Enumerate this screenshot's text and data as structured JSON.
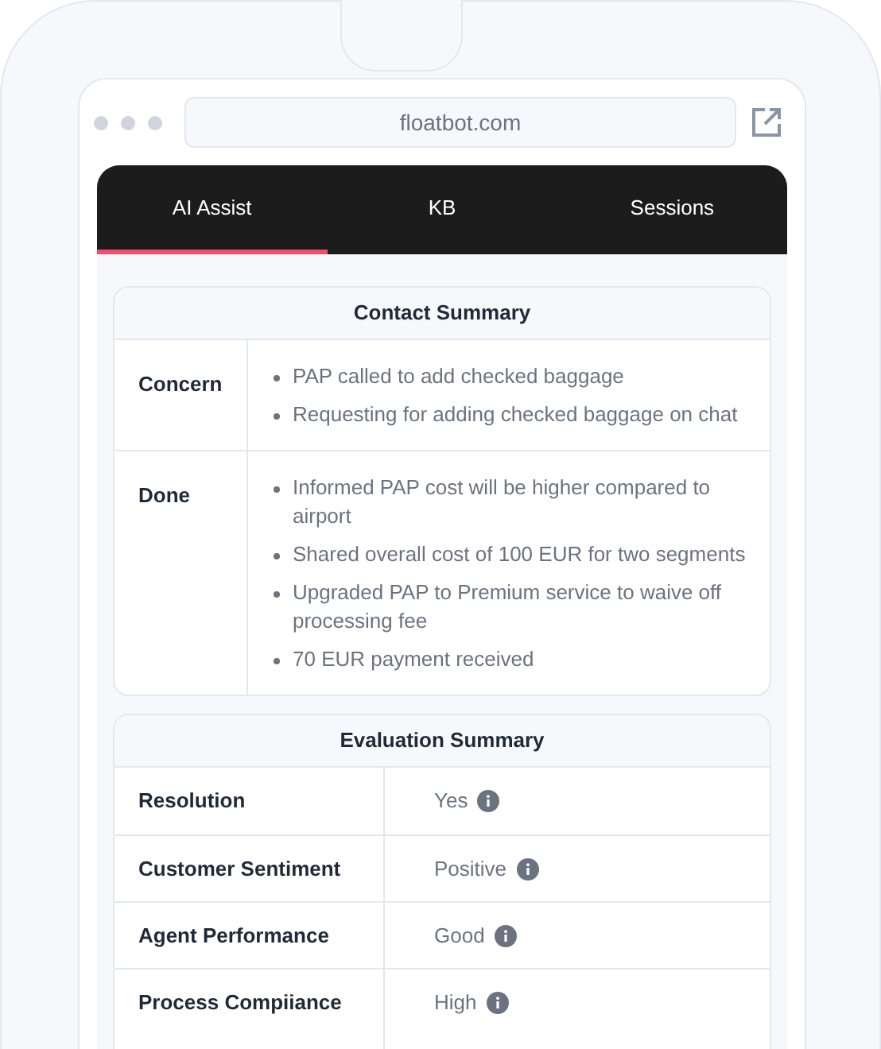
{
  "browser": {
    "url": "floatbot.com"
  },
  "tabs": [
    {
      "label": "AI Assist",
      "selected": true
    },
    {
      "label": "KB",
      "selected": false
    },
    {
      "label": "Sessions",
      "selected": false
    }
  ],
  "contact_summary": {
    "title": "Contact Summary",
    "rows": [
      {
        "label": "Concern",
        "items": [
          "PAP called to add checked baggage",
          "Requesting for adding checked baggage on chat"
        ]
      },
      {
        "label": "Done",
        "items": [
          "Informed PAP cost will be higher compared to airport",
          "Shared overall cost of 100 EUR for two segments",
          "Upgraded PAP to Premium service to waive off processing fee",
          "70 EUR payment received"
        ]
      }
    ]
  },
  "evaluation_summary": {
    "title": "Evaluation Summary",
    "rows": [
      {
        "label": "Resolution",
        "value": "Yes"
      },
      {
        "label": "Customer Sentiment",
        "value": "Positive"
      },
      {
        "label": "Agent Performance",
        "value": "Good"
      },
      {
        "label": "Process Compiiance",
        "value": "High"
      }
    ]
  }
}
